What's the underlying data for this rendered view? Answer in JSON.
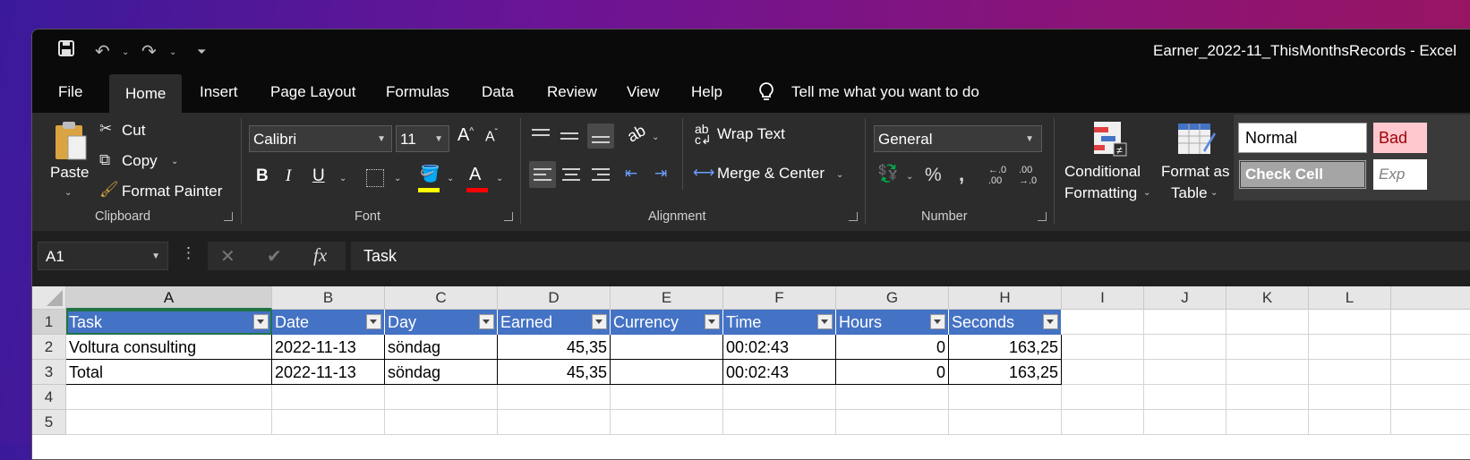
{
  "window": {
    "title": "Earner_2022-11_ThisMonthsRecords  -  Excel"
  },
  "quick_access": {
    "icons": [
      "save-icon",
      "undo-icon",
      "redo-icon",
      "customize-icon"
    ]
  },
  "menu": {
    "tabs": [
      "File",
      "Home",
      "Insert",
      "Page Layout",
      "Formulas",
      "Data",
      "Review",
      "View",
      "Help"
    ],
    "active": "Home",
    "tell_me": "Tell me what you want to do"
  },
  "ribbon": {
    "clipboard": {
      "paste": "Paste",
      "cut": "Cut",
      "copy": "Copy",
      "format_painter": "Format Painter",
      "label": "Clipboard"
    },
    "font": {
      "name": "Calibri",
      "size": "11",
      "bold": "B",
      "italic": "I",
      "underline": "U",
      "label": "Font"
    },
    "alignment": {
      "wrap_text": "Wrap Text",
      "merge_center": "Merge & Center",
      "label": "Alignment"
    },
    "number": {
      "format": "General",
      "percent": "%",
      "comma": ",",
      "label": "Number"
    },
    "styles": {
      "conditional_line1": "Conditional",
      "conditional_line2": "Formatting",
      "format_as_table_line1": "Format as",
      "format_as_table_line2": "Table",
      "normal": "Normal",
      "bad": "Bad",
      "check_cell": "Check Cell",
      "explanatory": "Exp"
    }
  },
  "formula_bar": {
    "name_box": "A1",
    "fx": "fx",
    "content": "Task"
  },
  "sheet": {
    "columns": [
      "A",
      "B",
      "C",
      "D",
      "E",
      "F",
      "G",
      "H",
      "I",
      "J",
      "K",
      "L"
    ],
    "row_numbers": [
      "1",
      "2",
      "3",
      "4",
      "5"
    ],
    "headers": [
      "Task",
      "Date",
      "Day",
      "Earned",
      "Currency",
      "Time",
      "Hours",
      "Seconds"
    ],
    "rows": [
      [
        "Voltura consulting",
        "2022-11-13",
        "söndag",
        "45,35",
        "",
        "00:02:43",
        "0",
        "163,25"
      ],
      [
        "Total",
        "2022-11-13",
        "söndag",
        "45,35",
        "",
        "00:02:43",
        "0",
        "163,25"
      ]
    ]
  }
}
